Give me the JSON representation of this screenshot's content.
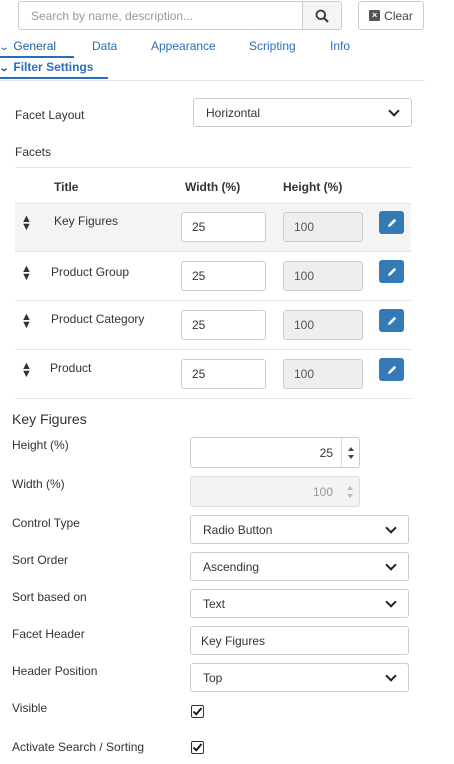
{
  "search": {
    "placeholder": "Search by name, description..."
  },
  "clear_label": "Clear",
  "tabs": [
    {
      "label": "General",
      "active": true
    },
    {
      "label": "Data"
    },
    {
      "label": "Appearance"
    },
    {
      "label": "Scripting"
    },
    {
      "label": "Info"
    }
  ],
  "section_title": "Filter Settings",
  "facet_layout": {
    "label": "Facet Layout",
    "value": "Horizontal"
  },
  "facets": {
    "label": "Facets",
    "columns": {
      "title": "Title",
      "width": "Width (%)",
      "height": "Height (%)"
    },
    "rows": [
      {
        "title": "Key Figures",
        "width": "25",
        "height": "100"
      },
      {
        "title": "Product Group",
        "width": "25",
        "height": "100"
      },
      {
        "title": "Product Category",
        "width": "25",
        "height": "100"
      },
      {
        "title": "Product",
        "width": "25",
        "height": "100"
      }
    ]
  },
  "detail": {
    "title": "Key Figures",
    "height": {
      "label": "Height (%)",
      "value": "25"
    },
    "width": {
      "label": "Width (%)",
      "value": "100"
    },
    "control_type": {
      "label": "Control Type",
      "value": "Radio Button"
    },
    "sort_order": {
      "label": "Sort Order",
      "value": "Ascending"
    },
    "sort_based_on": {
      "label": "Sort based on",
      "value": "Text"
    },
    "facet_header": {
      "label": "Facet Header",
      "value": "Key Figures"
    },
    "header_position": {
      "label": "Header Position",
      "value": "Top"
    },
    "visible": {
      "label": "Visible",
      "checked": true
    },
    "activate_search": {
      "label": "Activate Search / Sorting",
      "checked": true
    }
  },
  "colors": {
    "accent": "#2a6ebb",
    "button": "#337ab7"
  }
}
